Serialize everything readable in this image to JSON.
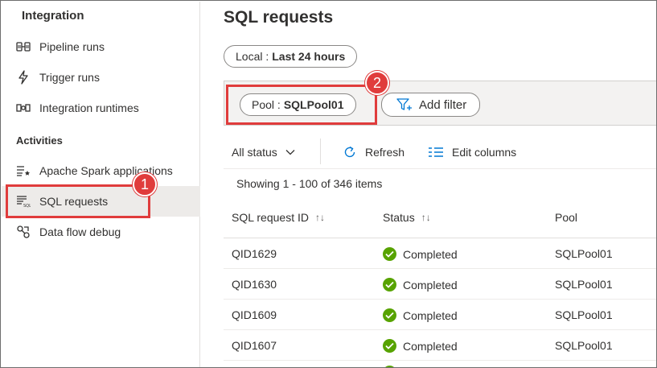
{
  "sidebar": {
    "integration_heading": "Integration",
    "integration_items": [
      {
        "label": "Pipeline runs",
        "icon": "pipeline-icon"
      },
      {
        "label": "Trigger runs",
        "icon": "trigger-icon"
      },
      {
        "label": "Integration runtimes",
        "icon": "runtime-icon"
      }
    ],
    "activities_heading": "Activities",
    "activities_items": [
      {
        "label": "Apache Spark applications",
        "icon": "spark-icon"
      },
      {
        "label": "SQL requests",
        "icon": "sql-icon",
        "active": true
      },
      {
        "label": "Data flow debug",
        "icon": "dataflow-icon"
      }
    ]
  },
  "callouts": {
    "one": "1",
    "two": "2",
    "color": "#e03c3c"
  },
  "main": {
    "title": "SQL requests",
    "time_filter": {
      "prefix": "Local :",
      "value": "Last 24 hours"
    },
    "pool_filter": {
      "prefix": "Pool :",
      "value": "SQLPool01"
    },
    "add_filter_label": "Add filter",
    "toolbar": {
      "status_label": "All status",
      "refresh_label": "Refresh",
      "edit_columns_label": "Edit columns"
    },
    "showing_text": "Showing 1 - 100 of 346 items",
    "columns": [
      "SQL request ID",
      "Status",
      "Pool"
    ],
    "rows": [
      {
        "id": "QID1629",
        "status": "Completed",
        "pool": "SQLPool01"
      },
      {
        "id": "QID1630",
        "status": "Completed",
        "pool": "SQLPool01"
      },
      {
        "id": "QID1609",
        "status": "Completed",
        "pool": "SQLPool01"
      },
      {
        "id": "QID1607",
        "status": "Completed",
        "pool": "SQLPool01"
      }
    ]
  },
  "colors": {
    "accent": "#0078d4",
    "success": "#57a300"
  }
}
